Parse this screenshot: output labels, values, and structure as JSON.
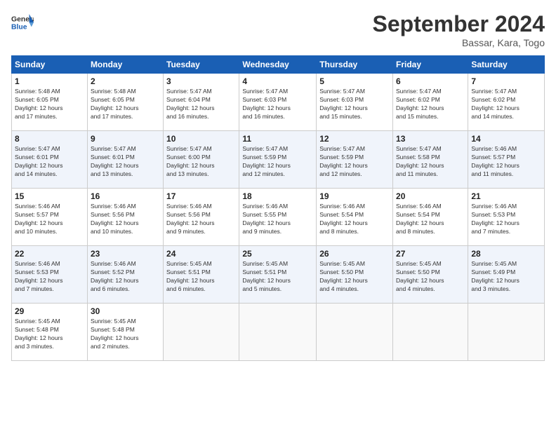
{
  "header": {
    "title": "September 2024",
    "location": "Bassar, Kara, Togo"
  },
  "calendar": {
    "headers": [
      "Sunday",
      "Monday",
      "Tuesday",
      "Wednesday",
      "Thursday",
      "Friday",
      "Saturday"
    ],
    "rows": [
      [
        {
          "day": "1",
          "info": "Sunrise: 5:48 AM\nSunset: 6:05 PM\nDaylight: 12 hours\nand 17 minutes."
        },
        {
          "day": "2",
          "info": "Sunrise: 5:48 AM\nSunset: 6:05 PM\nDaylight: 12 hours\nand 17 minutes."
        },
        {
          "day": "3",
          "info": "Sunrise: 5:47 AM\nSunset: 6:04 PM\nDaylight: 12 hours\nand 16 minutes."
        },
        {
          "day": "4",
          "info": "Sunrise: 5:47 AM\nSunset: 6:03 PM\nDaylight: 12 hours\nand 16 minutes."
        },
        {
          "day": "5",
          "info": "Sunrise: 5:47 AM\nSunset: 6:03 PM\nDaylight: 12 hours\nand 15 minutes."
        },
        {
          "day": "6",
          "info": "Sunrise: 5:47 AM\nSunset: 6:02 PM\nDaylight: 12 hours\nand 15 minutes."
        },
        {
          "day": "7",
          "info": "Sunrise: 5:47 AM\nSunset: 6:02 PM\nDaylight: 12 hours\nand 14 minutes."
        }
      ],
      [
        {
          "day": "8",
          "info": "Sunrise: 5:47 AM\nSunset: 6:01 PM\nDaylight: 12 hours\nand 14 minutes."
        },
        {
          "day": "9",
          "info": "Sunrise: 5:47 AM\nSunset: 6:01 PM\nDaylight: 12 hours\nand 13 minutes."
        },
        {
          "day": "10",
          "info": "Sunrise: 5:47 AM\nSunset: 6:00 PM\nDaylight: 12 hours\nand 13 minutes."
        },
        {
          "day": "11",
          "info": "Sunrise: 5:47 AM\nSunset: 5:59 PM\nDaylight: 12 hours\nand 12 minutes."
        },
        {
          "day": "12",
          "info": "Sunrise: 5:47 AM\nSunset: 5:59 PM\nDaylight: 12 hours\nand 12 minutes."
        },
        {
          "day": "13",
          "info": "Sunrise: 5:47 AM\nSunset: 5:58 PM\nDaylight: 12 hours\nand 11 minutes."
        },
        {
          "day": "14",
          "info": "Sunrise: 5:46 AM\nSunset: 5:57 PM\nDaylight: 12 hours\nand 11 minutes."
        }
      ],
      [
        {
          "day": "15",
          "info": "Sunrise: 5:46 AM\nSunset: 5:57 PM\nDaylight: 12 hours\nand 10 minutes."
        },
        {
          "day": "16",
          "info": "Sunrise: 5:46 AM\nSunset: 5:56 PM\nDaylight: 12 hours\nand 10 minutes."
        },
        {
          "day": "17",
          "info": "Sunrise: 5:46 AM\nSunset: 5:56 PM\nDaylight: 12 hours\nand 9 minutes."
        },
        {
          "day": "18",
          "info": "Sunrise: 5:46 AM\nSunset: 5:55 PM\nDaylight: 12 hours\nand 9 minutes."
        },
        {
          "day": "19",
          "info": "Sunrise: 5:46 AM\nSunset: 5:54 PM\nDaylight: 12 hours\nand 8 minutes."
        },
        {
          "day": "20",
          "info": "Sunrise: 5:46 AM\nSunset: 5:54 PM\nDaylight: 12 hours\nand 8 minutes."
        },
        {
          "day": "21",
          "info": "Sunrise: 5:46 AM\nSunset: 5:53 PM\nDaylight: 12 hours\nand 7 minutes."
        }
      ],
      [
        {
          "day": "22",
          "info": "Sunrise: 5:46 AM\nSunset: 5:53 PM\nDaylight: 12 hours\nand 7 minutes."
        },
        {
          "day": "23",
          "info": "Sunrise: 5:46 AM\nSunset: 5:52 PM\nDaylight: 12 hours\nand 6 minutes."
        },
        {
          "day": "24",
          "info": "Sunrise: 5:45 AM\nSunset: 5:51 PM\nDaylight: 12 hours\nand 6 minutes."
        },
        {
          "day": "25",
          "info": "Sunrise: 5:45 AM\nSunset: 5:51 PM\nDaylight: 12 hours\nand 5 minutes."
        },
        {
          "day": "26",
          "info": "Sunrise: 5:45 AM\nSunset: 5:50 PM\nDaylight: 12 hours\nand 4 minutes."
        },
        {
          "day": "27",
          "info": "Sunrise: 5:45 AM\nSunset: 5:50 PM\nDaylight: 12 hours\nand 4 minutes."
        },
        {
          "day": "28",
          "info": "Sunrise: 5:45 AM\nSunset: 5:49 PM\nDaylight: 12 hours\nand 3 minutes."
        }
      ],
      [
        {
          "day": "29",
          "info": "Sunrise: 5:45 AM\nSunset: 5:48 PM\nDaylight: 12 hours\nand 3 minutes."
        },
        {
          "day": "30",
          "info": "Sunrise: 5:45 AM\nSunset: 5:48 PM\nDaylight: 12 hours\nand 2 minutes."
        },
        {
          "day": "",
          "info": ""
        },
        {
          "day": "",
          "info": ""
        },
        {
          "day": "",
          "info": ""
        },
        {
          "day": "",
          "info": ""
        },
        {
          "day": "",
          "info": ""
        }
      ]
    ]
  }
}
